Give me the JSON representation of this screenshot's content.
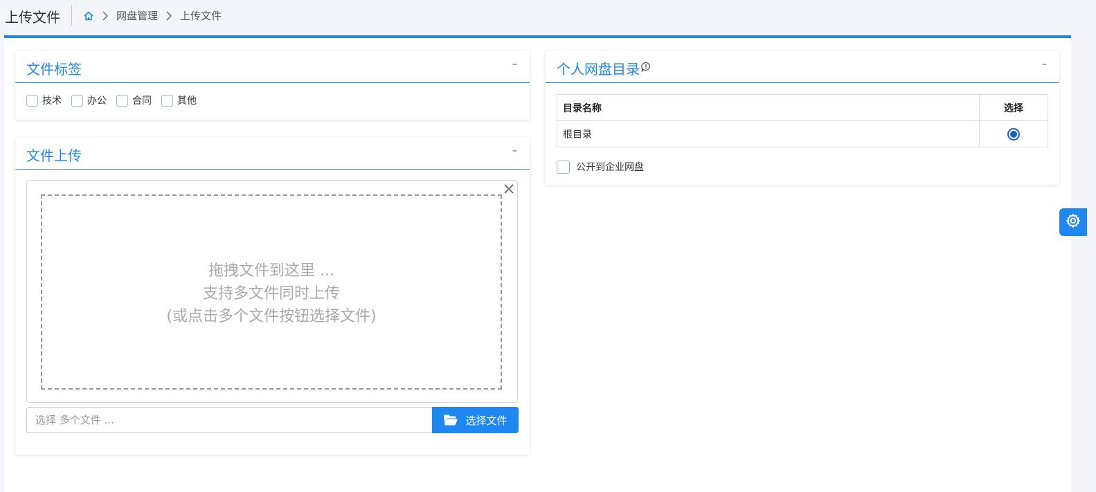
{
  "header": {
    "title": "上传文件",
    "breadcrumb": [
      "网盘管理",
      "上传文件"
    ]
  },
  "tags_card": {
    "title": "文件标签",
    "collapse_label": "–",
    "tags": [
      "技术",
      "办公",
      "合同",
      "其他"
    ]
  },
  "upload_card": {
    "title": "文件上传",
    "collapse_label": "–",
    "drop_line1": "拖拽文件到这里 ...",
    "drop_line2": "支持多文件同时上传",
    "drop_line3": "(或点击多个文件按钮选择文件)",
    "input_placeholder": "选择 多个文件 ...",
    "browse_label": "选择文件"
  },
  "directory_card": {
    "title": "个人网盘目录",
    "collapse_label": "–",
    "columns": [
      "目录名称",
      "选择"
    ],
    "rows": [
      {
        "name": "根目录",
        "selected": true
      }
    ],
    "public_label": "公开到企业网盘"
  },
  "colors": {
    "accent": "#1e88f0",
    "page_bg": "#f3f5fa",
    "radio": "#1560c8"
  },
  "icons": [
    "home-icon",
    "chevron-right-icon",
    "info-icon",
    "close-icon",
    "folder-open-icon",
    "gear-icon"
  ]
}
